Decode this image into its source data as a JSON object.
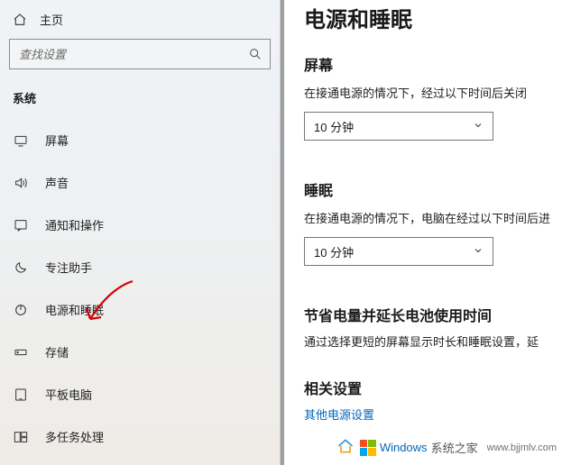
{
  "home_label": "主页",
  "search_placeholder": "查找设置",
  "section_title": "系统",
  "nav": [
    {
      "label": "屏幕"
    },
    {
      "label": "声音"
    },
    {
      "label": "通知和操作"
    },
    {
      "label": "专注助手"
    },
    {
      "label": "电源和睡眠"
    },
    {
      "label": "存储"
    },
    {
      "label": "平板电脑"
    },
    {
      "label": "多任务处理"
    }
  ],
  "page_title": "电源和睡眠",
  "screen": {
    "title": "屏幕",
    "desc": "在接通电源的情况下，经过以下时间后关闭",
    "value": "10 分钟"
  },
  "sleep": {
    "title": "睡眠",
    "desc": "在接通电源的情况下，电脑在经过以下时间后进",
    "value": "10 分钟"
  },
  "battery": {
    "title": "节省电量并延长电池使用时间",
    "desc": "通过选择更短的屏幕显示时长和睡眠设置，延"
  },
  "related_title": "相关设置",
  "related_link": "其他电源设置",
  "watermark": {
    "brand1": "Windows",
    "brand2": "系统之家",
    "url": "www.bjjmlv.com"
  }
}
